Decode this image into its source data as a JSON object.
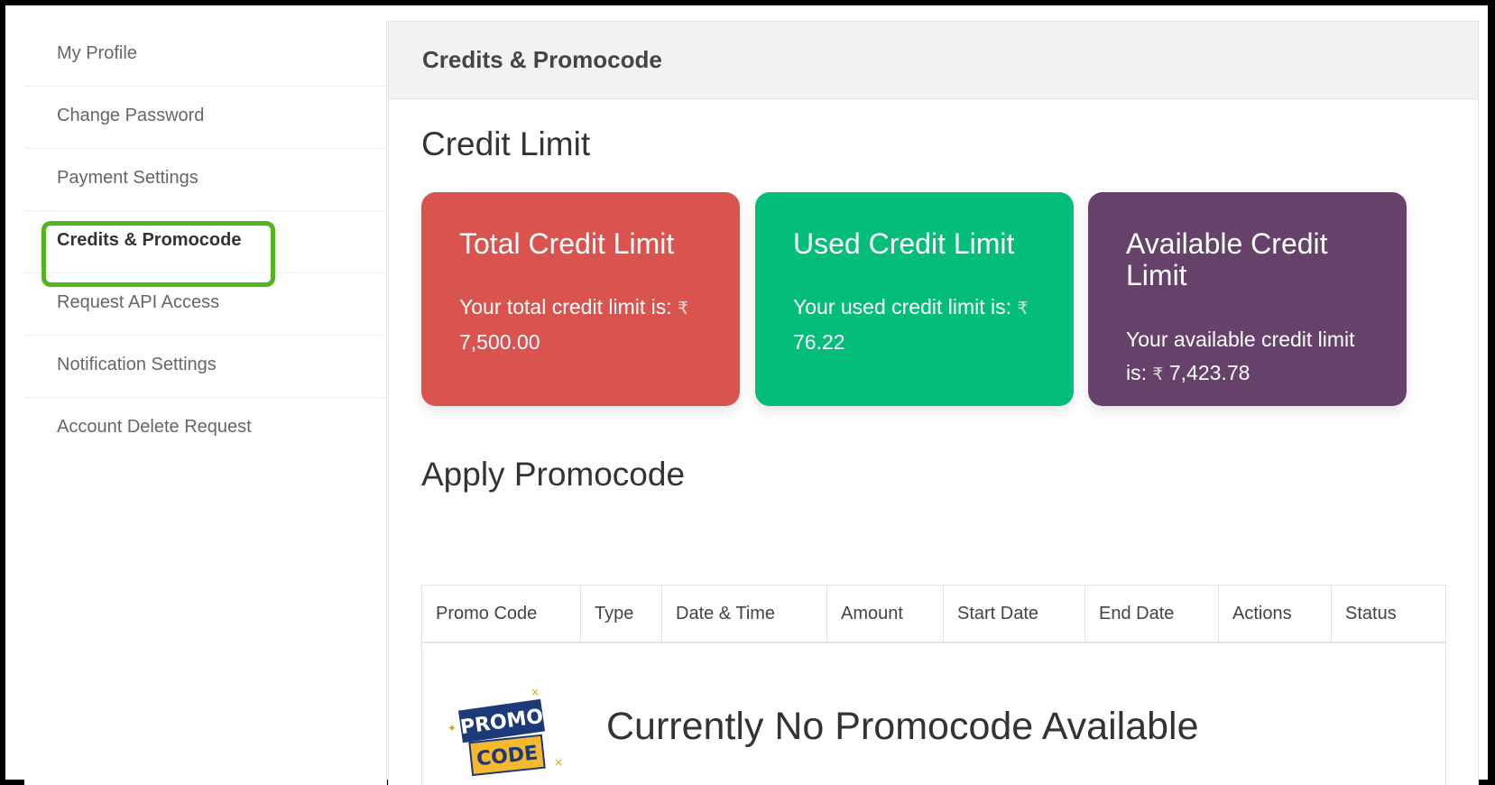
{
  "sidebar": {
    "items": [
      {
        "label": "My Profile"
      },
      {
        "label": "Change Password"
      },
      {
        "label": "Payment Settings"
      },
      {
        "label": "Credits & Promocode",
        "active": true
      },
      {
        "label": "Request API Access"
      },
      {
        "label": "Notification Settings"
      },
      {
        "label": "Account Delete Request"
      }
    ],
    "highlight_color": "#52b51d"
  },
  "main": {
    "header_title": "Credits & Promocode",
    "credit_section_title": "Credit Limit",
    "cards": [
      {
        "title": "Total Credit Limit",
        "text": "Your total credit limit is:",
        "currency": "₹",
        "amount": "7,500.00",
        "color": "#d9534f"
      },
      {
        "title": "Used Credit Limit",
        "text": "Your used credit limit is:",
        "currency": "₹",
        "amount": "76.22",
        "color": "#04bd78"
      },
      {
        "title": "Available Credit Limit",
        "text": "Your available credit limit is:",
        "currency": "₹",
        "amount": "7,423.78",
        "color": "#66426b"
      }
    ],
    "promo_section_title": "Apply Promocode",
    "table": {
      "columns": [
        "Promo Code",
        "Type",
        "Date & Time",
        "Amount",
        "Start Date",
        "End Date",
        "Actions",
        "Status"
      ],
      "empty_message": "Currently No Promocode Available",
      "empty_icon": "promo-code-icon",
      "empty_icon_text": [
        "PROMO",
        "CODE"
      ]
    }
  }
}
